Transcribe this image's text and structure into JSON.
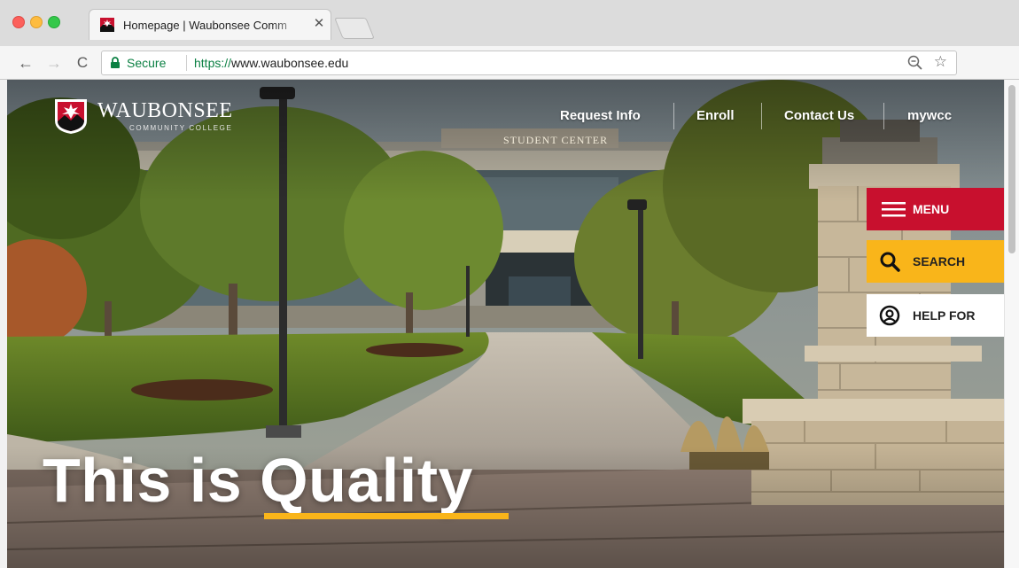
{
  "browser": {
    "tab": {
      "title": "Homepage | Waubonsee Comm",
      "close_glyph": "✕"
    },
    "nav": {
      "back": "←",
      "forward": "→",
      "reload": "C"
    },
    "address": {
      "secure_label": "Secure",
      "url_scheme": "https://",
      "url_host": "www.waubonsee.edu"
    },
    "star_glyph": "☆"
  },
  "site": {
    "logo": {
      "wordmark": "WAUBONSEE",
      "subtitle": "COMMUNITY COLLEGE"
    },
    "topnav": [
      {
        "label": "Request Info"
      },
      {
        "label": "Enroll"
      },
      {
        "label": "Contact Us"
      },
      {
        "label": "mywcc"
      }
    ],
    "side_buttons": {
      "menu": "MENU",
      "search": "SEARCH",
      "help": "HELP FOR"
    },
    "hero": {
      "headline_prefix": "This is ",
      "headline_emphasis": "Quality",
      "sign_text": "STUDENT CENTER"
    },
    "colors": {
      "brand_red": "#c8102e",
      "brand_gold": "#f9b51a",
      "secure_green": "#0b8043"
    }
  }
}
